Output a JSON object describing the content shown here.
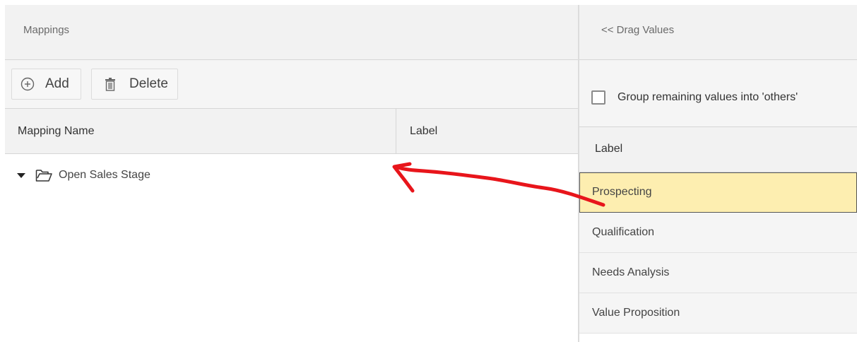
{
  "mappings": {
    "title": "Mappings",
    "toolbar": {
      "add_label": "Add",
      "delete_label": "Delete"
    },
    "columns": {
      "name": "Mapping Name",
      "label": "Label"
    },
    "tree": [
      {
        "name": "Open Sales Stage",
        "expanded": true
      }
    ]
  },
  "drag_values": {
    "title": "<< Drag Values",
    "group_checkbox_label": "Group remaining values into 'others'",
    "group_checked": false,
    "column_header": "Label",
    "items": [
      "Prospecting",
      "Qualification",
      "Needs Analysis",
      "Value Proposition"
    ],
    "selected_item": "Prospecting"
  },
  "colors": {
    "selected_bg": "#fdeeb0",
    "arrow": "#e8151b",
    "header_bg": "#f2f2f2"
  },
  "icons": {
    "add": "plus-circle-icon",
    "delete": "trash-icon",
    "expand": "caret-down-icon",
    "folder": "folder-open-icon"
  }
}
